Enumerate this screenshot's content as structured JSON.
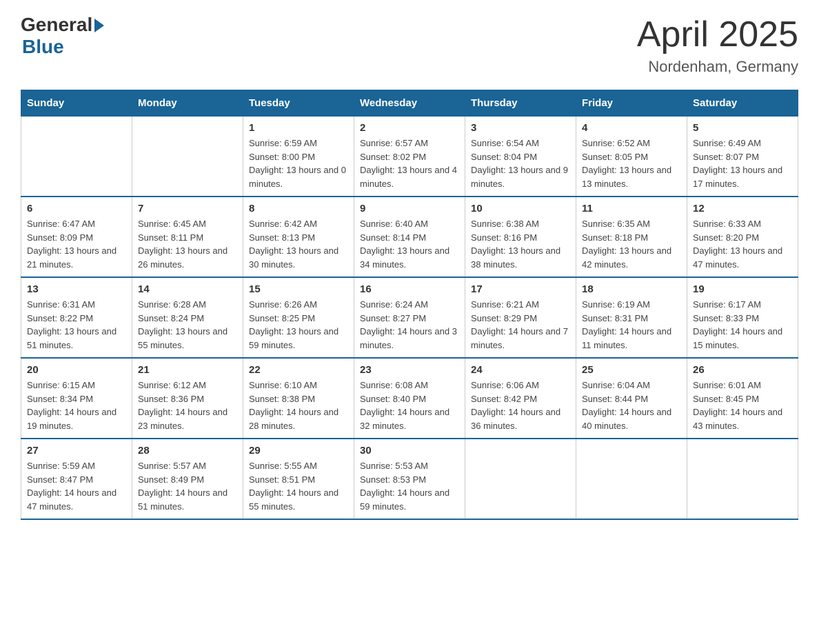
{
  "header": {
    "logo_general": "General",
    "logo_blue": "Blue",
    "month_title": "April 2025",
    "location": "Nordenham, Germany"
  },
  "weekdays": [
    "Sunday",
    "Monday",
    "Tuesday",
    "Wednesday",
    "Thursday",
    "Friday",
    "Saturday"
  ],
  "weeks": [
    [
      {
        "day": "",
        "sunrise": "",
        "sunset": "",
        "daylight": ""
      },
      {
        "day": "",
        "sunrise": "",
        "sunset": "",
        "daylight": ""
      },
      {
        "day": "1",
        "sunrise": "Sunrise: 6:59 AM",
        "sunset": "Sunset: 8:00 PM",
        "daylight": "Daylight: 13 hours and 0 minutes."
      },
      {
        "day": "2",
        "sunrise": "Sunrise: 6:57 AM",
        "sunset": "Sunset: 8:02 PM",
        "daylight": "Daylight: 13 hours and 4 minutes."
      },
      {
        "day": "3",
        "sunrise": "Sunrise: 6:54 AM",
        "sunset": "Sunset: 8:04 PM",
        "daylight": "Daylight: 13 hours and 9 minutes."
      },
      {
        "day": "4",
        "sunrise": "Sunrise: 6:52 AM",
        "sunset": "Sunset: 8:05 PM",
        "daylight": "Daylight: 13 hours and 13 minutes."
      },
      {
        "day": "5",
        "sunrise": "Sunrise: 6:49 AM",
        "sunset": "Sunset: 8:07 PM",
        "daylight": "Daylight: 13 hours and 17 minutes."
      }
    ],
    [
      {
        "day": "6",
        "sunrise": "Sunrise: 6:47 AM",
        "sunset": "Sunset: 8:09 PM",
        "daylight": "Daylight: 13 hours and 21 minutes."
      },
      {
        "day": "7",
        "sunrise": "Sunrise: 6:45 AM",
        "sunset": "Sunset: 8:11 PM",
        "daylight": "Daylight: 13 hours and 26 minutes."
      },
      {
        "day": "8",
        "sunrise": "Sunrise: 6:42 AM",
        "sunset": "Sunset: 8:13 PM",
        "daylight": "Daylight: 13 hours and 30 minutes."
      },
      {
        "day": "9",
        "sunrise": "Sunrise: 6:40 AM",
        "sunset": "Sunset: 8:14 PM",
        "daylight": "Daylight: 13 hours and 34 minutes."
      },
      {
        "day": "10",
        "sunrise": "Sunrise: 6:38 AM",
        "sunset": "Sunset: 8:16 PM",
        "daylight": "Daylight: 13 hours and 38 minutes."
      },
      {
        "day": "11",
        "sunrise": "Sunrise: 6:35 AM",
        "sunset": "Sunset: 8:18 PM",
        "daylight": "Daylight: 13 hours and 42 minutes."
      },
      {
        "day": "12",
        "sunrise": "Sunrise: 6:33 AM",
        "sunset": "Sunset: 8:20 PM",
        "daylight": "Daylight: 13 hours and 47 minutes."
      }
    ],
    [
      {
        "day": "13",
        "sunrise": "Sunrise: 6:31 AM",
        "sunset": "Sunset: 8:22 PM",
        "daylight": "Daylight: 13 hours and 51 minutes."
      },
      {
        "day": "14",
        "sunrise": "Sunrise: 6:28 AM",
        "sunset": "Sunset: 8:24 PM",
        "daylight": "Daylight: 13 hours and 55 minutes."
      },
      {
        "day": "15",
        "sunrise": "Sunrise: 6:26 AM",
        "sunset": "Sunset: 8:25 PM",
        "daylight": "Daylight: 13 hours and 59 minutes."
      },
      {
        "day": "16",
        "sunrise": "Sunrise: 6:24 AM",
        "sunset": "Sunset: 8:27 PM",
        "daylight": "Daylight: 14 hours and 3 minutes."
      },
      {
        "day": "17",
        "sunrise": "Sunrise: 6:21 AM",
        "sunset": "Sunset: 8:29 PM",
        "daylight": "Daylight: 14 hours and 7 minutes."
      },
      {
        "day": "18",
        "sunrise": "Sunrise: 6:19 AM",
        "sunset": "Sunset: 8:31 PM",
        "daylight": "Daylight: 14 hours and 11 minutes."
      },
      {
        "day": "19",
        "sunrise": "Sunrise: 6:17 AM",
        "sunset": "Sunset: 8:33 PM",
        "daylight": "Daylight: 14 hours and 15 minutes."
      }
    ],
    [
      {
        "day": "20",
        "sunrise": "Sunrise: 6:15 AM",
        "sunset": "Sunset: 8:34 PM",
        "daylight": "Daylight: 14 hours and 19 minutes."
      },
      {
        "day": "21",
        "sunrise": "Sunrise: 6:12 AM",
        "sunset": "Sunset: 8:36 PM",
        "daylight": "Daylight: 14 hours and 23 minutes."
      },
      {
        "day": "22",
        "sunrise": "Sunrise: 6:10 AM",
        "sunset": "Sunset: 8:38 PM",
        "daylight": "Daylight: 14 hours and 28 minutes."
      },
      {
        "day": "23",
        "sunrise": "Sunrise: 6:08 AM",
        "sunset": "Sunset: 8:40 PM",
        "daylight": "Daylight: 14 hours and 32 minutes."
      },
      {
        "day": "24",
        "sunrise": "Sunrise: 6:06 AM",
        "sunset": "Sunset: 8:42 PM",
        "daylight": "Daylight: 14 hours and 36 minutes."
      },
      {
        "day": "25",
        "sunrise": "Sunrise: 6:04 AM",
        "sunset": "Sunset: 8:44 PM",
        "daylight": "Daylight: 14 hours and 40 minutes."
      },
      {
        "day": "26",
        "sunrise": "Sunrise: 6:01 AM",
        "sunset": "Sunset: 8:45 PM",
        "daylight": "Daylight: 14 hours and 43 minutes."
      }
    ],
    [
      {
        "day": "27",
        "sunrise": "Sunrise: 5:59 AM",
        "sunset": "Sunset: 8:47 PM",
        "daylight": "Daylight: 14 hours and 47 minutes."
      },
      {
        "day": "28",
        "sunrise": "Sunrise: 5:57 AM",
        "sunset": "Sunset: 8:49 PM",
        "daylight": "Daylight: 14 hours and 51 minutes."
      },
      {
        "day": "29",
        "sunrise": "Sunrise: 5:55 AM",
        "sunset": "Sunset: 8:51 PM",
        "daylight": "Daylight: 14 hours and 55 minutes."
      },
      {
        "day": "30",
        "sunrise": "Sunrise: 5:53 AM",
        "sunset": "Sunset: 8:53 PM",
        "daylight": "Daylight: 14 hours and 59 minutes."
      },
      {
        "day": "",
        "sunrise": "",
        "sunset": "",
        "daylight": ""
      },
      {
        "day": "",
        "sunrise": "",
        "sunset": "",
        "daylight": ""
      },
      {
        "day": "",
        "sunrise": "",
        "sunset": "",
        "daylight": ""
      }
    ]
  ]
}
